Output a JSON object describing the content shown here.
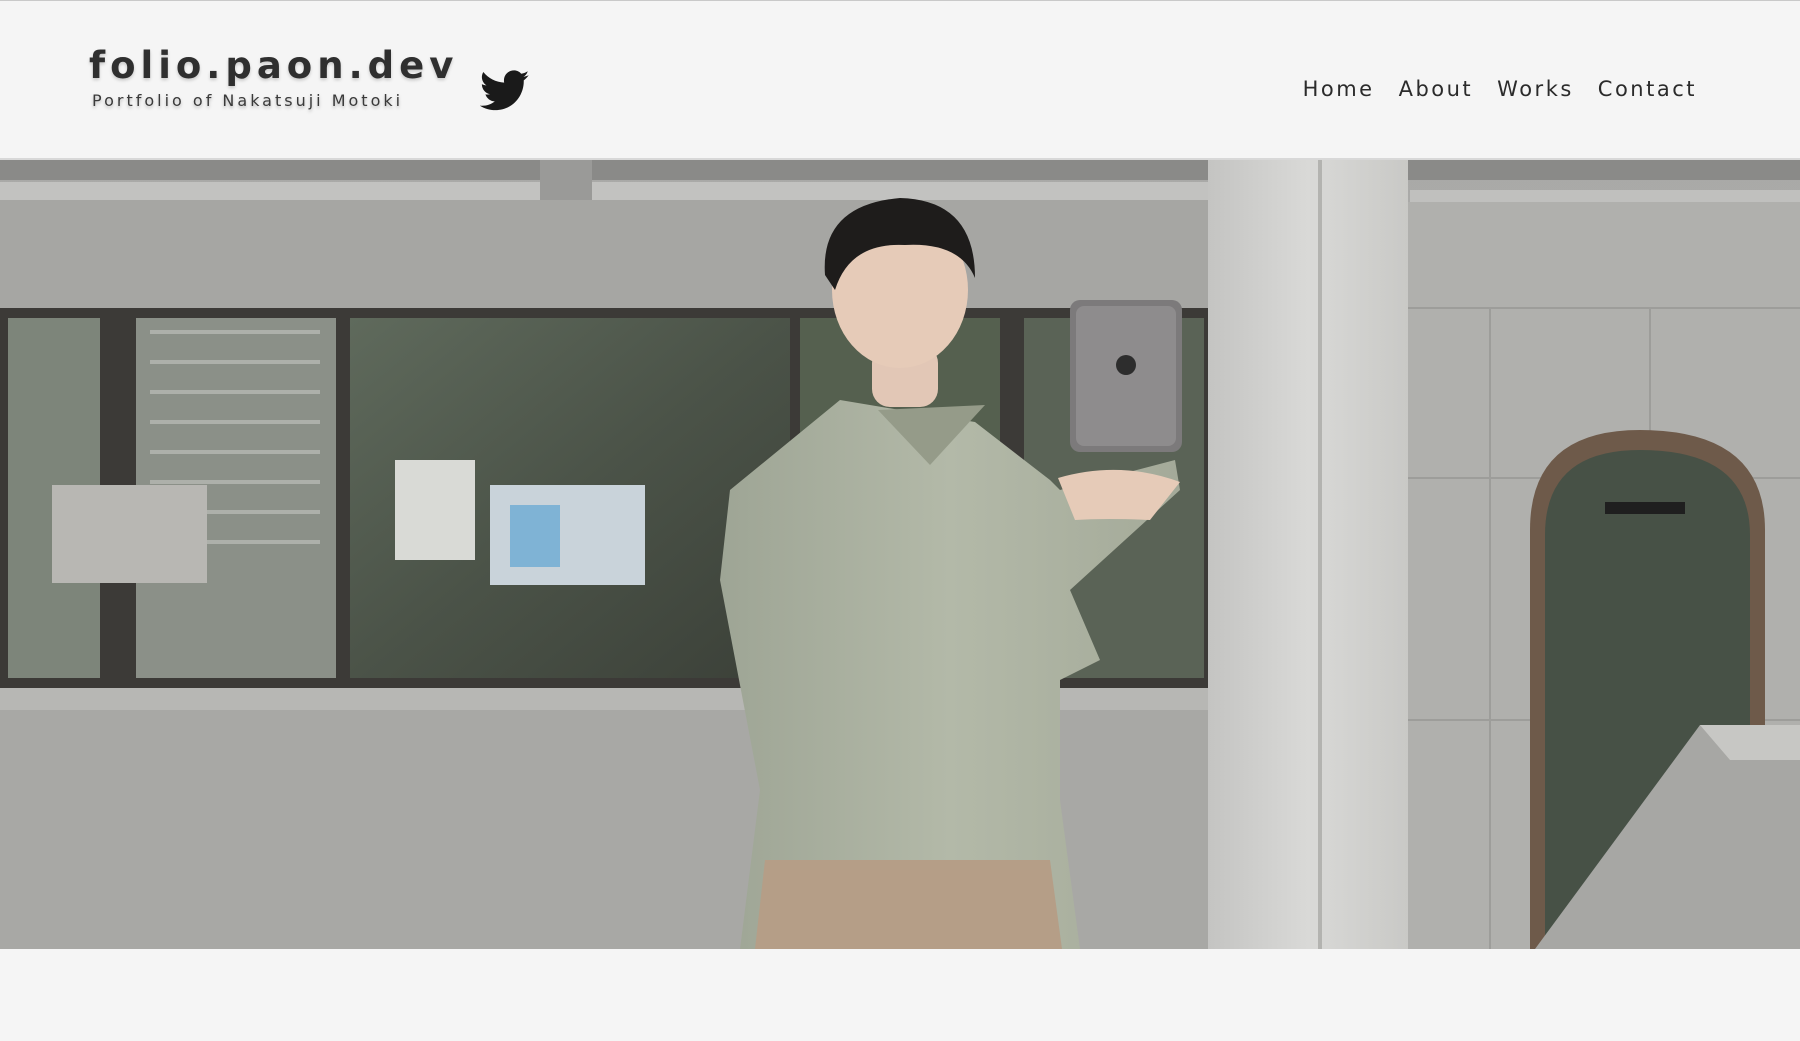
{
  "site": {
    "title": "folio.paon.dev",
    "subtitle": "Portfolio of Nakatsuji Motoki"
  },
  "social": {
    "twitter_icon": "twitter-bird-icon"
  },
  "nav": {
    "items": [
      {
        "label": "Home"
      },
      {
        "label": "About"
      },
      {
        "label": "Works"
      },
      {
        "label": "Contact"
      }
    ]
  },
  "hero": {
    "image_subject": "portrait-holding-tablet"
  },
  "colors": {
    "background": "#f5f5f5",
    "text": "#2b2b2b"
  }
}
